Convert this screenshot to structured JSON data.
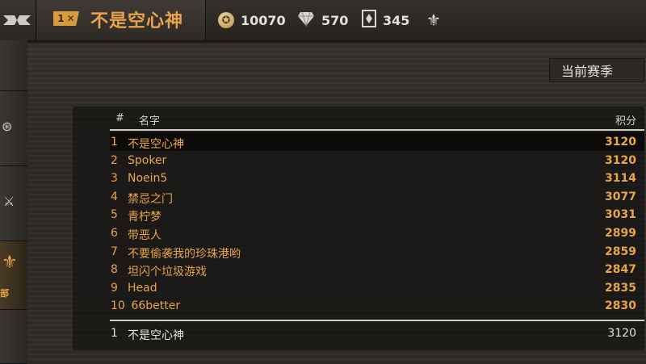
{
  "player": {
    "rank_badge": "1",
    "name": "不是空心神"
  },
  "currencies": [
    {
      "icon": "coin-icon",
      "value": "10070"
    },
    {
      "icon": "diamond-icon",
      "value": "570"
    },
    {
      "icon": "token-icon",
      "value": "345"
    }
  ],
  "sidebar": {
    "active_label": "部"
  },
  "season_button": "当前赛季",
  "table": {
    "headers": {
      "rank": "#",
      "name": "名字",
      "score": "积分"
    },
    "rows": [
      {
        "rank": "1",
        "name": "不是空心神",
        "score": "3120"
      },
      {
        "rank": "2",
        "name": "Spoker",
        "score": "3120"
      },
      {
        "rank": "3",
        "name": "Noein5",
        "score": "3114"
      },
      {
        "rank": "4",
        "name": "禁忌之门",
        "score": "3077"
      },
      {
        "rank": "5",
        "name": "青柠梦",
        "score": "3031"
      },
      {
        "rank": "6",
        "name": "带恶人",
        "score": "2899"
      },
      {
        "rank": "7",
        "name": "不要偷袭我的珍珠港哟",
        "score": "2859"
      },
      {
        "rank": "8",
        "name": "坦闪个垃圾游戏",
        "score": "2847"
      },
      {
        "rank": "9",
        "name": "Head",
        "score": "2835"
      },
      {
        "rank": "10",
        "name": " 66better",
        "score": "2830"
      }
    ],
    "my_row": {
      "rank": "1",
      "name": "不是空心神",
      "score": "3120"
    }
  },
  "colors": {
    "accent": "#e8a44a",
    "text": "#e6e2dc",
    "background": "#2c2925"
  }
}
